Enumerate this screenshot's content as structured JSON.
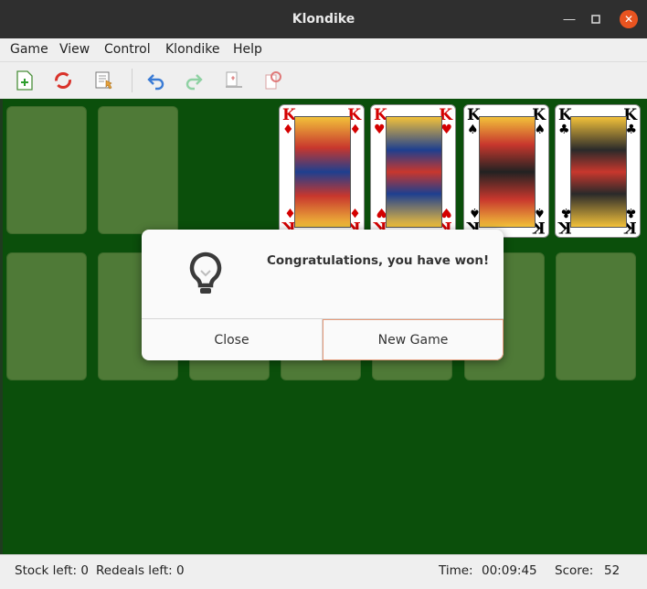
{
  "window": {
    "title": "Klondike"
  },
  "menu": [
    "Game",
    "View",
    "Control",
    "Klondike",
    "Help"
  ],
  "dialog": {
    "icon": "lightbulb-icon",
    "message": "Congratulations, you have won!",
    "close_label": "Close",
    "new_game_label": "New Game"
  },
  "foundations": [
    {
      "rank": "K",
      "suit": "♦",
      "color": "#d40000"
    },
    {
      "rank": "K",
      "suit": "♥",
      "color": "#d40000"
    },
    {
      "rank": "K",
      "suit": "♠",
      "color": "#000000"
    },
    {
      "rank": "K",
      "suit": "♣",
      "color": "#000000"
    }
  ],
  "status": {
    "stock": "Stock left: 0",
    "redeals": "Redeals left: 0",
    "time_label": "Time:",
    "time": "00:09:45",
    "score_label": "Score:",
    "score": "52"
  },
  "colors": {
    "felt": "#0b4f0b",
    "slot": "#4f7a37",
    "accent": "#e95420"
  }
}
